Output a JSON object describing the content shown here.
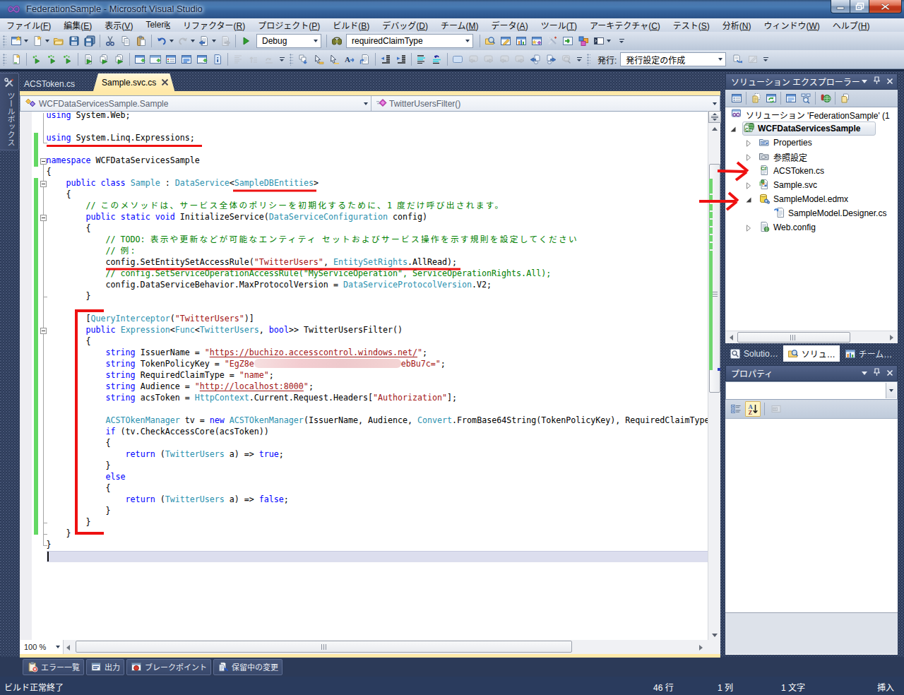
{
  "window_title": "FederationSample - Microsoft Visual Studio",
  "window_controls": {
    "minimize": "minimize",
    "restore": "restore",
    "close": "close"
  },
  "menu": [
    {
      "label": "ファイル",
      "key": "F"
    },
    {
      "label": "編集",
      "key": "E"
    },
    {
      "label": "表示",
      "key": "V"
    },
    {
      "label": "Telerik",
      "key": "k",
      "inline": true
    },
    {
      "label": "リファクター",
      "key": "R"
    },
    {
      "label": "プロジェクト",
      "key": "P"
    },
    {
      "label": "ビルド",
      "key": "B"
    },
    {
      "label": "デバッグ",
      "key": "D"
    },
    {
      "label": "チーム",
      "key": "M"
    },
    {
      "label": "データ",
      "key": "A"
    },
    {
      "label": "ツール",
      "key": "T"
    },
    {
      "label": "アーキテクチャ",
      "key": "C"
    },
    {
      "label": "テスト",
      "key": "S"
    },
    {
      "label": "分析",
      "key": "N"
    },
    {
      "label": "ウィンドウ",
      "key": "W"
    },
    {
      "label": "ヘルプ",
      "key": "H"
    }
  ],
  "toolbar1": {
    "debug_combo": "Debug",
    "search_combo": "requiredClaimType",
    "items_note": "standard toolbar",
    "icons": [
      "new-project",
      "add-item",
      "open-file",
      "save",
      "save-all",
      "cut",
      "copy",
      "paste",
      "undo",
      "redo",
      "navigate-back",
      "navigate-forward",
      "start-debug",
      "find",
      "find-in-files",
      "properties-window",
      "solution-explorer",
      "object-browser",
      "toolbox",
      "extension-manager",
      "start-page",
      "command-window"
    ]
  },
  "toolbar2": {
    "publish_label": "発行:",
    "publish_combo": "発行設定の作成",
    "icons": [
      "new-query",
      "display-data",
      "step-setting",
      "step-setting2",
      "attach",
      "processes",
      "process-page",
      "breakpoints-window",
      "immediate-window",
      "watch-window",
      "output-window",
      "locals-window",
      "call-stack",
      "indent-off",
      "indent-on",
      "wrap-off",
      "show-docs",
      "list-members",
      "parameter-info",
      "word-completion",
      "quick-info",
      "decrease-indent",
      "increase-indent",
      "comment",
      "uncomment",
      "bookmark-toggle",
      "bookmark-prev",
      "bookmark-next",
      "bookmark-prev-folder",
      "bookmark-next-folder",
      "bookmark-prev-doc",
      "bookmark-next-doc",
      "bookmark-clear",
      "publish-web",
      "publish-edit"
    ]
  },
  "editor_tabs": [
    {
      "label": "ACSToken.cs",
      "active": false
    },
    {
      "label": "Sample.svc.cs",
      "active": true
    }
  ],
  "navbar": {
    "scope": "WCFDataServicesSample.Sample",
    "member": "TwitterUsersFilter()"
  },
  "toolbox_tab": "ツールボックス",
  "zoom_control": "100 %",
  "code_lines": [
    [
      [
        "k",
        "using"
      ],
      [
        "p",
        " System.Web;"
      ]
    ],
    [],
    [
      [
        "k",
        "using"
      ],
      [
        "p",
        " System.Linq.Expressions;"
      ]
    ],
    [],
    [
      [
        "k",
        "namespace"
      ],
      [
        "p",
        " WCFDataServicesSample"
      ]
    ],
    [
      [
        "p",
        "{"
      ]
    ],
    [
      [
        "p",
        "    "
      ],
      [
        "k",
        "public"
      ],
      [
        "p",
        " "
      ],
      [
        "k",
        "class"
      ],
      [
        "p",
        " "
      ],
      [
        "t",
        "Sample"
      ],
      [
        "p",
        " : "
      ],
      [
        "t",
        "DataService"
      ],
      [
        "p",
        "<"
      ],
      [
        "t",
        "SampleDBEntities"
      ],
      [
        "p",
        ">"
      ]
    ],
    [
      [
        "p",
        "    {"
      ]
    ],
    [
      [
        "c",
        "        // このメソッドは、サービス全体のポリシーを初期化するために、1 度だけ呼び出されます。"
      ]
    ],
    [
      [
        "p",
        "        "
      ],
      [
        "k",
        "public"
      ],
      [
        "p",
        " "
      ],
      [
        "k",
        "static"
      ],
      [
        "p",
        " "
      ],
      [
        "k",
        "void"
      ],
      [
        "p",
        " InitializeService("
      ],
      [
        "t",
        "DataServiceConfiguration"
      ],
      [
        "p",
        " config)"
      ]
    ],
    [
      [
        "p",
        "        {"
      ]
    ],
    [
      [
        "c",
        "            // TODO: 表示や更新などが可能なエンティティ セットおよびサービス操作を示す規則を設定してください"
      ]
    ],
    [
      [
        "c",
        "            // 例:"
      ]
    ],
    [
      [
        "p",
        "            config.SetEntitySetAccessRule("
      ],
      [
        "s",
        "\"TwitterUsers\""
      ],
      [
        "p",
        ", "
      ],
      [
        "t",
        "EntitySetRights"
      ],
      [
        "p",
        ".AllRead);"
      ]
    ],
    [
      [
        "c",
        "            // config.SetServiceOperationAccessRule(\"MyServiceOperation\", ServiceOperationRights.All);"
      ]
    ],
    [
      [
        "p",
        "            config.DataServiceBehavior.MaxProtocolVersion = "
      ],
      [
        "t",
        "DataServiceProtocolVersion"
      ],
      [
        "p",
        ".V2;"
      ]
    ],
    [
      [
        "p",
        "        }"
      ]
    ],
    [],
    [
      [
        "p",
        "        ["
      ],
      [
        "t",
        "QueryInterceptor"
      ],
      [
        "p",
        "("
      ],
      [
        "s",
        "\"TwitterUsers\""
      ],
      [
        "p",
        ")]"
      ]
    ],
    [
      [
        "p",
        "        "
      ],
      [
        "k",
        "public"
      ],
      [
        "p",
        " "
      ],
      [
        "t",
        "Expression"
      ],
      [
        "p",
        "<"
      ],
      [
        "t",
        "Func"
      ],
      [
        "p",
        "<"
      ],
      [
        "t",
        "TwitterUsers"
      ],
      [
        "p",
        ", "
      ],
      [
        "k",
        "bool"
      ],
      [
        "p",
        ">> TwitterUsersFilter()"
      ]
    ],
    [
      [
        "p",
        "        {"
      ]
    ],
    [
      [
        "p",
        "            "
      ],
      [
        "k",
        "string"
      ],
      [
        "p",
        " IssuerName = "
      ],
      [
        "s",
        "\""
      ],
      [
        "su",
        "https://buchizo.accesscontrol.windows.net/"
      ],
      [
        "s",
        "\""
      ],
      [
        "p",
        ";"
      ]
    ],
    [
      [
        "p",
        "            "
      ],
      [
        "k",
        "string"
      ],
      [
        "p",
        " TokenPolicyKey = "
      ],
      [
        "s",
        "\"EgZ8e"
      ],
      [
        "blur",
        ""
      ],
      [
        "s",
        "ebBu7c=\""
      ],
      [
        "p",
        ";"
      ]
    ],
    [
      [
        "p",
        "            "
      ],
      [
        "k",
        "string"
      ],
      [
        "p",
        " RequiredClaimType = "
      ],
      [
        "s",
        "\"name\""
      ],
      [
        "p",
        ";"
      ]
    ],
    [
      [
        "p",
        "            "
      ],
      [
        "k",
        "string"
      ],
      [
        "p",
        " Audience = "
      ],
      [
        "s",
        "\""
      ],
      [
        "su",
        "http://localhost:8000"
      ],
      [
        "s",
        "\""
      ],
      [
        "p",
        ";"
      ]
    ],
    [
      [
        "p",
        "            "
      ],
      [
        "k",
        "string"
      ],
      [
        "p",
        " acsToken = "
      ],
      [
        "t",
        "HttpContext"
      ],
      [
        "p",
        ".Current.Request.Headers["
      ],
      [
        "s",
        "\"Authorization\""
      ],
      [
        "p",
        "];"
      ]
    ],
    [],
    [
      [
        "p",
        "            "
      ],
      [
        "t",
        "ACSTOkenManager"
      ],
      [
        "p",
        " tv = "
      ],
      [
        "k",
        "new"
      ],
      [
        "p",
        " "
      ],
      [
        "t",
        "ACSTOkenManager"
      ],
      [
        "p",
        "(IssuerName, Audience, "
      ],
      [
        "t",
        "Convert"
      ],
      [
        "p",
        ".FromBase64String(TokenPolicyKey), RequiredClaimType"
      ]
    ],
    [
      [
        "p",
        "            "
      ],
      [
        "k",
        "if"
      ],
      [
        "p",
        " (tv.CheckAccessCore(acsToken))"
      ]
    ],
    [
      [
        "p",
        "            {"
      ]
    ],
    [
      [
        "p",
        "                "
      ],
      [
        "k",
        "return"
      ],
      [
        "p",
        " ("
      ],
      [
        "t",
        "TwitterUsers"
      ],
      [
        "p",
        " a) => "
      ],
      [
        "k",
        "true"
      ],
      [
        "p",
        ";"
      ]
    ],
    [
      [
        "p",
        "            }"
      ]
    ],
    [
      [
        "p",
        "            "
      ],
      [
        "k",
        "else"
      ]
    ],
    [
      [
        "p",
        "            {"
      ]
    ],
    [
      [
        "p",
        "                "
      ],
      [
        "k",
        "return"
      ],
      [
        "p",
        " ("
      ],
      [
        "t",
        "TwitterUsers"
      ],
      [
        "p",
        " a) => "
      ],
      [
        "k",
        "false"
      ],
      [
        "p",
        ";"
      ]
    ],
    [
      [
        "p",
        "            }"
      ]
    ],
    [
      [
        "p",
        "        }"
      ]
    ],
    [
      [
        "p",
        "    }"
      ]
    ],
    [
      [
        "p",
        "}"
      ]
    ],
    []
  ],
  "solution_explorer": {
    "title": "ソリューション エクスプローラー",
    "toolbar_icons": [
      "se-properties",
      "se-show-all-files",
      "se-refresh",
      "se-view-code",
      "se-class-diagram",
      "se-view-browser",
      "se-copy-website"
    ],
    "tree": [
      {
        "label": "ソリューション 'FederationSample' (1",
        "icon": "solution",
        "indent": 0,
        "exp": "none",
        "bold": false,
        "selected": false
      },
      {
        "label": "WCFDataServicesSample",
        "icon": "project",
        "indent": 1,
        "exp": "expanded",
        "bold": true,
        "selected": true
      },
      {
        "label": "Properties",
        "icon": "folder-props",
        "indent": 2,
        "exp": "collapsed",
        "bold": false,
        "selected": false
      },
      {
        "label": "参照設定",
        "icon": "folder-ref",
        "indent": 2,
        "exp": "collapsed",
        "bold": false,
        "selected": false
      },
      {
        "label": "ACSToken.cs",
        "icon": "cs-file",
        "indent": 2,
        "exp": "none",
        "bold": false,
        "selected": false
      },
      {
        "label": "Sample.svc",
        "icon": "svc-file",
        "indent": 2,
        "exp": "collapsed",
        "bold": false,
        "selected": false
      },
      {
        "label": "SampleModel.edmx",
        "icon": "edmx-file",
        "indent": 2,
        "exp": "expanded",
        "bold": false,
        "selected": false
      },
      {
        "label": "SampleModel.Designer.cs",
        "icon": "designer-file",
        "indent": 3,
        "exp": "none",
        "bold": false,
        "selected": false
      },
      {
        "label": "Web.config",
        "icon": "config-file",
        "indent": 2,
        "exp": "collapsed",
        "bold": false,
        "selected": false
      }
    ]
  },
  "panel_tabs": [
    {
      "label": "Solutio…",
      "icon": "tab-search",
      "active": false
    },
    {
      "label": "ソリュ…",
      "icon": "tab-solution",
      "active": true
    },
    {
      "label": "チーム…",
      "icon": "tab-team",
      "active": false
    }
  ],
  "properties_panel": {
    "title": "プロパティ",
    "object_value": "",
    "toolbar_icons": [
      "prop-categorized",
      "prop-alphabetical",
      "prop-pages"
    ]
  },
  "bottom_tabs": [
    {
      "label": "エラー一覧",
      "icon": "error-list"
    },
    {
      "label": "出力",
      "icon": "output"
    },
    {
      "label": "ブレークポイント",
      "icon": "breakpoints"
    },
    {
      "label": "保留中の変更",
      "icon": "pending-changes"
    }
  ],
  "statusbar": {
    "message": "ビルド正常終了",
    "line": "46 行",
    "column": "1 列",
    "character": "1 文字",
    "mode": "挿入"
  },
  "colors": {
    "keyword": "#0000ff",
    "type": "#2b91af",
    "string": "#a31515",
    "comment": "#008000",
    "annotation": "#ee1111",
    "active_tab": "#ffe9a9",
    "change_bar": "#63d863",
    "background": "#2c3a58"
  }
}
